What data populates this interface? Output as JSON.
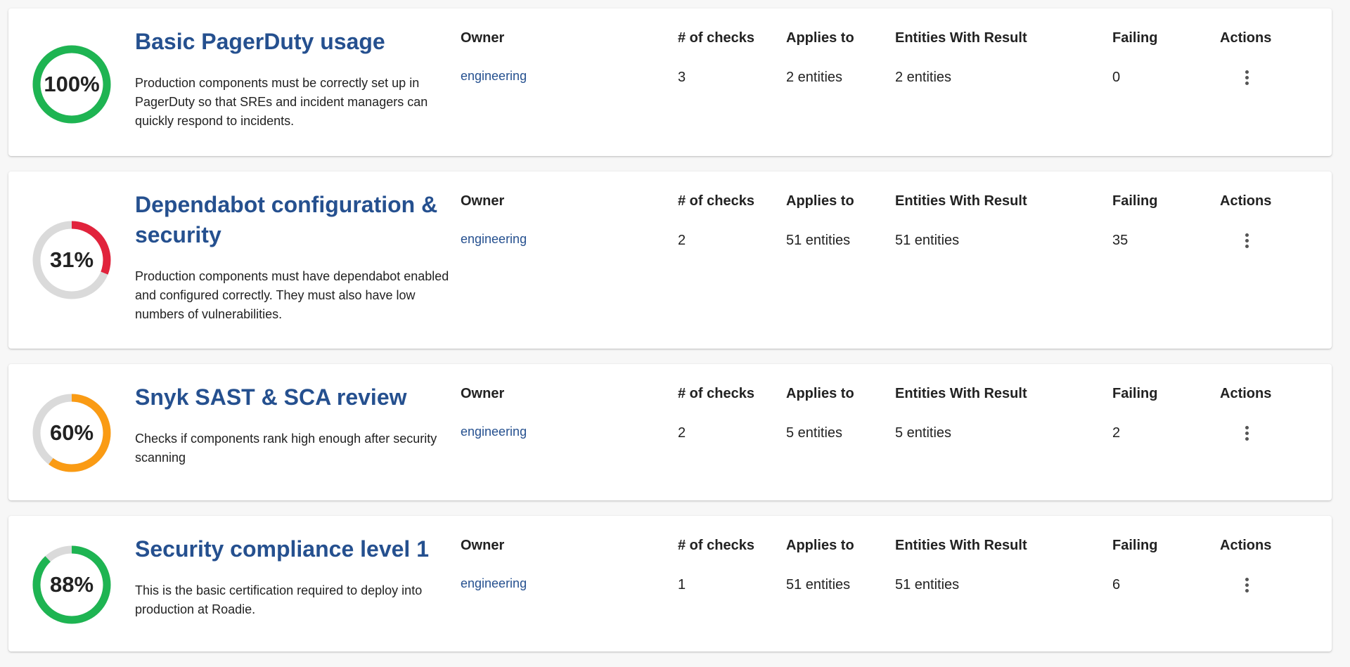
{
  "columns": {
    "owner": "Owner",
    "checks": "# of checks",
    "applies": "Applies to",
    "entities": "Entities With Result",
    "failing": "Failing",
    "actions": "Actions"
  },
  "colors": {
    "ring_track": "#dadada",
    "title_link": "#25508f"
  },
  "scorecards": [
    {
      "percent_label": "100%",
      "percent_value": 100,
      "ring_color": "#1eb452",
      "title": "Basic PagerDuty usage",
      "description": "Production components must be correctly set up in PagerDuty so that SREs and incident managers can quickly respond to incidents.",
      "owner": "engineering",
      "checks": "3",
      "applies_to": "2 entities",
      "entities_with_result": "2 entities",
      "failing": "0",
      "actions_icon": "more-vertical-icon"
    },
    {
      "percent_label": "31%",
      "percent_value": 31,
      "ring_color": "#e1233c",
      "title": "Dependabot configuration & security",
      "description": "Production components must have dependabot enabled and configured correctly. They must also have low numbers of vulnerabilities.",
      "owner": "engineering",
      "checks": "2",
      "applies_to": "51 entities",
      "entities_with_result": "51 entities",
      "failing": "35",
      "actions_icon": "more-vertical-icon"
    },
    {
      "percent_label": "60%",
      "percent_value": 60,
      "ring_color": "#fa9b14",
      "title": "Snyk SAST & SCA review",
      "description": "Checks if components rank high enough after security scanning",
      "owner": "engineering",
      "checks": "2",
      "applies_to": "5 entities",
      "entities_with_result": "5 entities",
      "failing": "2",
      "actions_icon": "more-vertical-icon"
    },
    {
      "percent_label": "88%",
      "percent_value": 88,
      "ring_color": "#1eb452",
      "title": "Security compliance level 1",
      "description": "This is the basic certification required to deploy into production at Roadie.",
      "owner": "engineering",
      "checks": "1",
      "applies_to": "51 entities",
      "entities_with_result": "51 entities",
      "failing": "6",
      "actions_icon": "more-vertical-icon"
    }
  ]
}
